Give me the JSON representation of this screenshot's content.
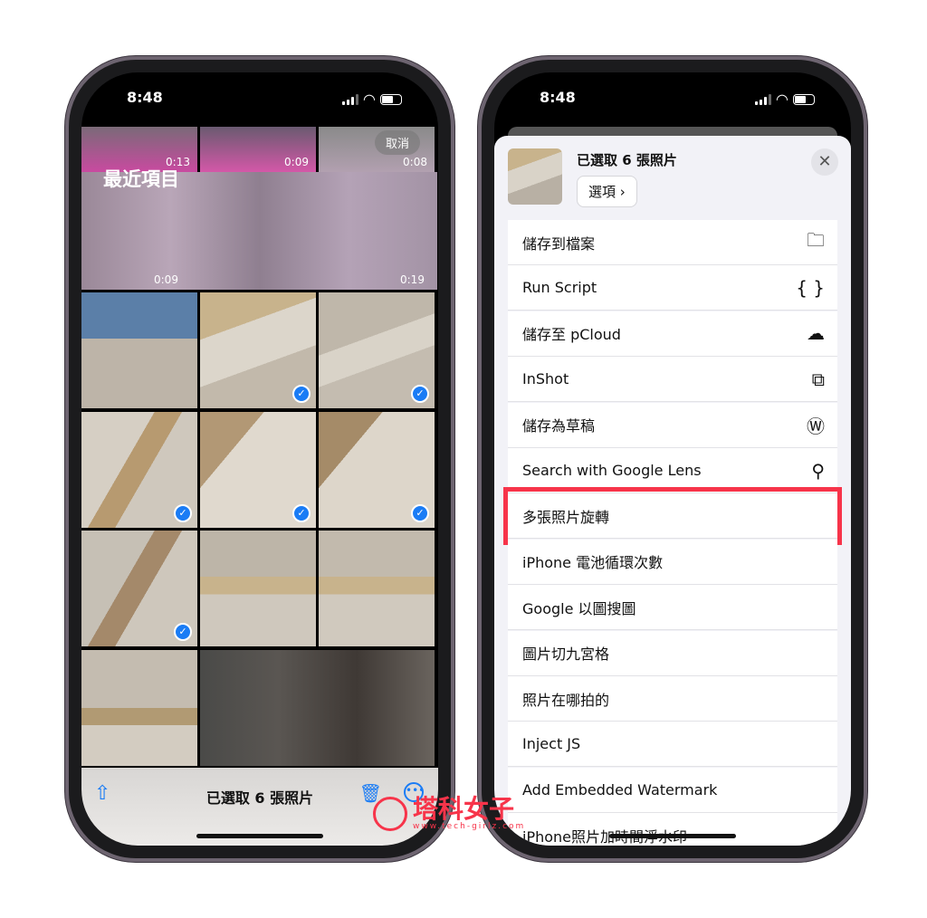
{
  "left": {
    "status": {
      "time": "8:48"
    },
    "cancel_label": "取消",
    "album_title": "最近項目",
    "durations": [
      "0:13",
      "0:09",
      "0:08",
      "0:08",
      "0:19"
    ],
    "toolbar": {
      "selection_label": "已選取 6 張照片",
      "share_icon": "share-icon",
      "trash_icon": "trash-icon",
      "more_icon": "ellipsis-circle-icon"
    },
    "accent": "#1a7cf5"
  },
  "right": {
    "status": {
      "time": "8:48"
    },
    "header": {
      "title": "已選取 6 張照片",
      "options_label": "選項 ›",
      "close_icon": "close-icon"
    },
    "actions": [
      {
        "label": "儲存到檔案",
        "icon": "folder-icon"
      },
      {
        "label": "Run Script",
        "icon": "braces-icon"
      },
      {
        "label": "儲存至 pCloud",
        "icon": "pcloud-icon"
      },
      {
        "label": "InShot",
        "icon": "crop-icon"
      },
      {
        "label": "儲存為草稿",
        "icon": "wordpress-icon"
      },
      {
        "label": "Search with Google Lens",
        "icon": "search-icon"
      },
      {
        "label": "多張照片旋轉",
        "highlighted": true
      },
      {
        "label": "iPhone 電池循環次數"
      },
      {
        "label": "Google 以圖搜圖"
      },
      {
        "label": "圖片切九宮格"
      },
      {
        "label": "照片在哪拍的"
      },
      {
        "label": "Inject JS"
      },
      {
        "label": "Add Embedded Watermark"
      },
      {
        "label": "iPhone照片加時間浮水印"
      }
    ],
    "highlight_color": "#f7344a"
  },
  "watermark": {
    "text": "塔科女子",
    "url": "www.tech-girlz.com"
  }
}
